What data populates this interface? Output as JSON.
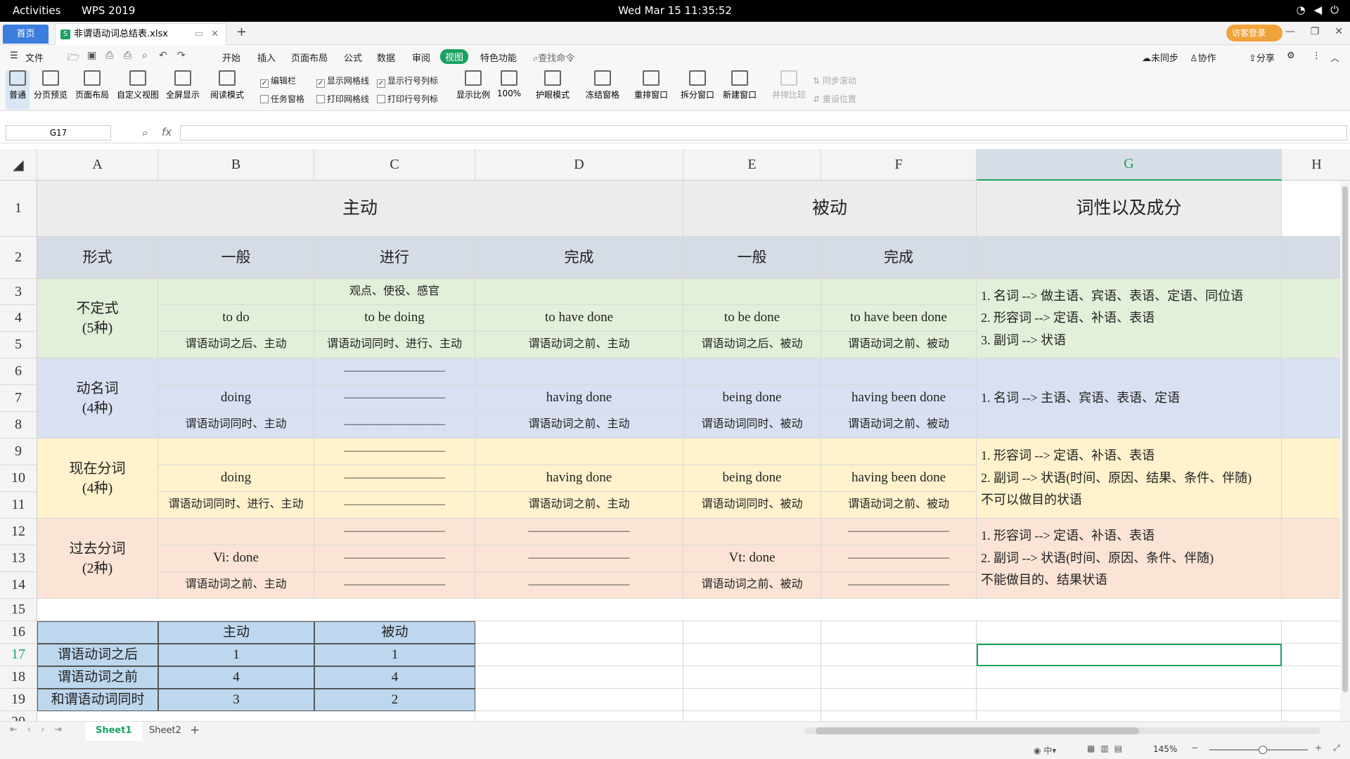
{
  "topbar": {
    "activities": "Activities",
    "app": "WPS 2019",
    "clock": "Wed Mar 15  11:35:52"
  },
  "tabs": {
    "home": "首页",
    "file": "非谓语动词总结表.xlsx",
    "guest": "访客登录"
  },
  "menu": [
    "开始",
    "插入",
    "页面布局",
    "公式",
    "数据",
    "审阅",
    "视图",
    "特色功能"
  ],
  "menu_active": "视图",
  "file_menu": "文件",
  "search_cmd": "查找命令",
  "right_menu": {
    "sync": "未同步",
    "collab": "协作",
    "share": "分享"
  },
  "ribbon": {
    "normal": "普通",
    "pagebreak": "分页预览",
    "pagelayout": "页面布局",
    "custom": "自定义视图",
    "fullscreen": "全屏显示",
    "reading": "阅读模式",
    "editbar": "编辑栏",
    "taskpane": "任务窗格",
    "showgrid": "显示网格线",
    "printgrid": "打印网格线",
    "showheaders": "显示行号列标",
    "printheaders": "打印行号列标",
    "zoom": "显示比例",
    "zoom100": "100%",
    "eyecare": "护眼模式",
    "freeze": "冻结窗格",
    "rearrange": "重排窗口",
    "split": "拆分窗口",
    "newwin": "新建窗口",
    "sidebyside": "并排比较",
    "syncscroll": "同步滚动",
    "resetpos": "重设位置"
  },
  "namebox": "G17",
  "fx": "fx",
  "columns": [
    "A",
    "B",
    "C",
    "D",
    "E",
    "F",
    "G",
    "H"
  ],
  "rows": [
    "1",
    "2",
    "3",
    "4",
    "5",
    "6",
    "7",
    "8",
    "9",
    "10",
    "11",
    "12",
    "13",
    "14",
    "15",
    "16",
    "17",
    "18",
    "19",
    "20"
  ],
  "sheet": {
    "r1": {
      "active": "主动",
      "passive": "被动",
      "pos": "词性以及成分"
    },
    "r2": {
      "a": "形式",
      "b": "一般",
      "c": "进行",
      "d": "完成",
      "e": "一般",
      "f": "完成"
    },
    "inf": {
      "label": "不定式\n(5种)",
      "c3": "观点、使役、感官",
      "b4": "to do",
      "c4": "to be doing",
      "d4": "to have done",
      "e4": "to be done",
      "f4": "to have been done",
      "b5": "谓语动词之后、主动",
      "c5": "谓语动词同时、进行、主动",
      "d5": "谓语动词之前、主动",
      "e5": "谓语动词之后、被动",
      "f5": "谓语动词之前、被动",
      "g": "1. 名词 --> 做主语、宾语、表语、定语、同位语\n2. 形容词 --> 定语、补语、表语\n3. 副词 --> 状语"
    },
    "ger": {
      "label": "动名词\n(4种)",
      "dash": "—————————",
      "b7": "doing",
      "d7": "having done",
      "e7": "being done",
      "f7": "having been done",
      "b8": "谓语动词同时、主动",
      "d8": "谓语动词之前、主动",
      "e8": "谓语动词同时、被动",
      "f8": "谓语动词之前、被动",
      "g": "1. 名词 --> 主语、宾语、表语、定语"
    },
    "pres": {
      "label": "现在分词\n(4种)",
      "b10": "doing",
      "d10": "having done",
      "e10": "being done",
      "f10": "having been done",
      "b11": "谓语动词同时、进行、主动",
      "d11": "谓语动词之前、主动",
      "e11": "谓语动词同时、被动",
      "f11": "谓语动词之前、被动",
      "g": "1. 形容词 --> 定语、补语、表语\n2. 副词 --> 状语(时间、原因、结果、条件、伴随)\n不可以做目的状语"
    },
    "past": {
      "label": "过去分词\n(2种)",
      "b13": "Vi: done",
      "e13": "Vt: done",
      "b14": "谓语动词之前、主动",
      "e14": "谓语动词之前、被动",
      "g": "1. 形容词 --> 定语、补语、表语\n2. 副词 --> 状语(时间、原因、条件、伴随)\n不能做目的、结果状语"
    },
    "summary": {
      "h_active": "主动",
      "h_passive": "被动",
      "rows": [
        {
          "label": "谓语动词之后",
          "a": "1",
          "p": "1"
        },
        {
          "label": "谓语动词之前",
          "a": "4",
          "p": "4"
        },
        {
          "label": "和谓语动词同时",
          "a": "3",
          "p": "2"
        }
      ]
    }
  },
  "colors": {
    "inf": "#e2efd9",
    "ger": "#d9e0f1",
    "pres": "#fff2cc",
    "past": "#fbe4d5",
    "header": "#d6dce5",
    "summary": "#bdd7ee",
    "accent": "#1aa260"
  },
  "sheets": [
    "Sheet1",
    "Sheet2"
  ],
  "active_sheet": "Sheet1",
  "status": {
    "zoom": "145%"
  }
}
